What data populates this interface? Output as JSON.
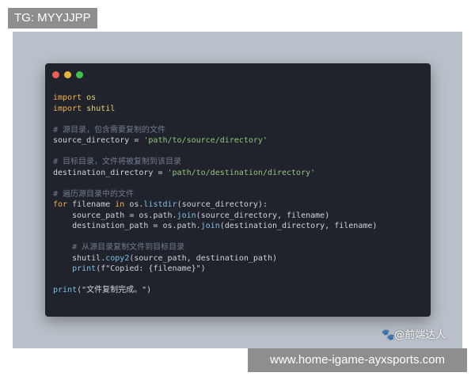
{
  "tag_label": "TG: MYYJJPP",
  "watermark": "🐾@前端达人",
  "url_banner": "www.home-igame-ayxsports.com",
  "window_dots": {
    "red": "#ec5f57",
    "yellow": "#e6b53c",
    "green": "#43c04b"
  },
  "code": {
    "l1_kw": "import",
    "l1_mod": "os",
    "l2_kw": "import",
    "l2_mod": "shutil",
    "c1": "# 源目录，包含需要复制的文件",
    "l3_var": "source_directory",
    "l3_op": " = ",
    "l3_str": "'path/to/source/directory'",
    "c2": "# 目标目录，文件将被复制到该目录",
    "l4_var": "destination_directory",
    "l4_op": " = ",
    "l4_str": "'path/to/destination/directory'",
    "c3": "# 遍历源目录中的文件",
    "l5_for": "for",
    "l5_var": " filename ",
    "l5_in": "in",
    "l5_a": " os.",
    "l5_fn": "listdir",
    "l5_b": "(source_directory):",
    "l6_a": "    source_path = os.path.",
    "l6_fn": "join",
    "l6_b": "(source_directory, filename)",
    "l7_a": "    destination_path = os.path.",
    "l7_fn": "join",
    "l7_b": "(destination_directory, filename)",
    "c4": "    # 从源目录复制文件到目标目录",
    "l8_a": "    shutil.",
    "l8_fn": "copy2",
    "l8_b": "(source_path, destination_path)",
    "l9_a": "    ",
    "l9_fn": "print",
    "l9_b": "(f\"Copied: {filename}\")",
    "l10_fn": "print",
    "l10_b": "(\"文件复制完成。\")"
  }
}
